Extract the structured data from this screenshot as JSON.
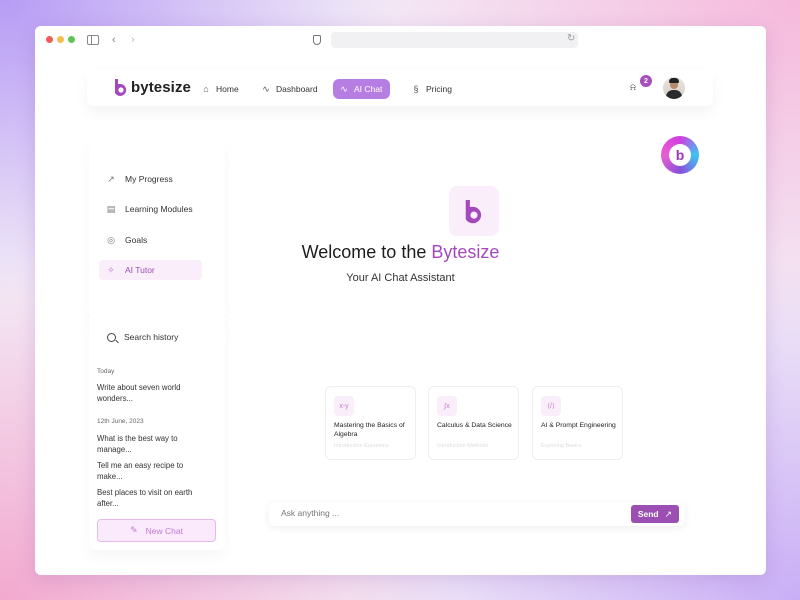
{
  "brand": {
    "name": "bytesize",
    "accent": "#a449bd",
    "accent_light": "#fbeefb"
  },
  "nav": {
    "items": [
      {
        "label": "Home",
        "icon": "home-icon"
      },
      {
        "label": "Dashboard",
        "icon": "activity-icon"
      },
      {
        "label": "AI Chat",
        "icon": "activity-icon",
        "active": true
      },
      {
        "label": "Pricing",
        "icon": "coin-icon"
      }
    ],
    "notifications": "2"
  },
  "sidebar": {
    "items": [
      {
        "label": "My Progress",
        "icon": "chart-icon"
      },
      {
        "label": "Learning Modules",
        "icon": "book-icon"
      },
      {
        "label": "Goals",
        "icon": "target-icon"
      },
      {
        "label": "AI Tutor",
        "icon": "sparkle-icon",
        "active": true
      }
    ]
  },
  "history": {
    "search_label": "Search history",
    "sections": [
      {
        "label": "Today",
        "entries": [
          "Write about seven world wonders..."
        ]
      },
      {
        "label": "12th June, 2023",
        "entries": [
          "What is the best way to manage...",
          "Tell me an easy recipe to make...",
          "Best places to visit on earth after..."
        ]
      }
    ],
    "new_chat_label": "New Chat"
  },
  "hero": {
    "title_prefix": "Welcome to the ",
    "title_brand": "Bytesize",
    "subtitle": "Your AI Chat Assistant"
  },
  "prompts": [
    {
      "icon_text": "x-y",
      "title": "Mastering the Basics of Algebra",
      "sub": "Introduction Equations"
    },
    {
      "icon_text": "∫x",
      "title": "Calculus & Data Science",
      "sub": "Introduction Methods"
    },
    {
      "icon_text": "⟨/⟩",
      "title": "AI & Prompt Engineering",
      "sub": "Exploring Basics"
    }
  ],
  "composer": {
    "placeholder": "Ask anything ...",
    "send_label": "Send"
  }
}
